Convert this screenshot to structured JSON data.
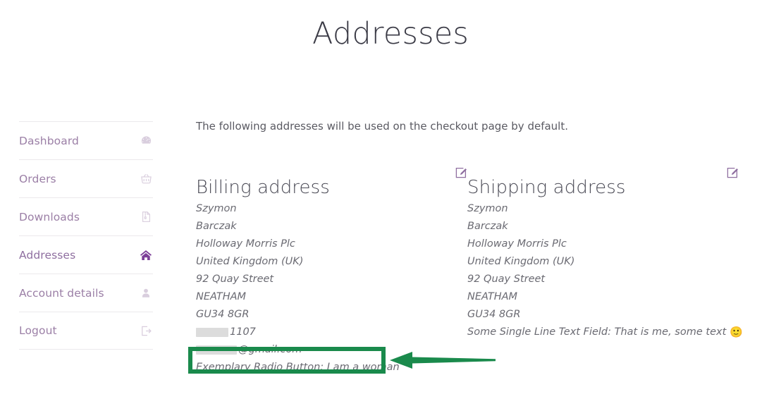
{
  "page": {
    "title": "Addresses",
    "intro": "The following addresses will be used on the checkout page by default."
  },
  "sidebar": {
    "items": [
      {
        "label": "Dashboard",
        "icon": "dashboard-icon",
        "active": false
      },
      {
        "label": "Orders",
        "icon": "basket-icon",
        "active": false
      },
      {
        "label": "Downloads",
        "icon": "file-zip-icon",
        "active": false
      },
      {
        "label": "Addresses",
        "icon": "home-icon",
        "active": true
      },
      {
        "label": "Account details",
        "icon": "user-icon",
        "active": false
      },
      {
        "label": "Logout",
        "icon": "sign-out-icon",
        "active": false
      }
    ]
  },
  "billing": {
    "title": "Billing address",
    "edit_icon": "edit-pencil-square-icon",
    "lines": [
      "Szymon",
      "Barczak",
      "Holloway Morris Plc",
      "United Kingdom (UK)",
      "92 Quay Street",
      "NEATHAM",
      "GU34 8GR"
    ],
    "phone_suffix": "1107",
    "email_suffix": "@gmail.com",
    "radio_line": "Exemplary Radio Button: I am a woman"
  },
  "shipping": {
    "title": "Shipping address",
    "edit_icon": "edit-pencil-square-icon",
    "lines": [
      "Szymon",
      "Barczak",
      "Holloway Morris Plc",
      "United Kingdom (UK)",
      "92 Quay Street",
      "NEATHAM",
      "GU34 8GR"
    ],
    "text_field_line": "Some Single Line Text Field: That is me, some text",
    "text_field_emoji": "🙂"
  },
  "annotation": {
    "highlight_color": "#1a8a4c",
    "arrow_color": "#1a8a4c",
    "target": "Exemplary Radio Button: I am a woman"
  },
  "colors": {
    "nav_link": "#9b7fa6",
    "nav_active_icon": "#7d3f98",
    "heading": "#4a4a55",
    "body_text": "#6a6a72",
    "edit_icon": "#8f6fa0"
  }
}
